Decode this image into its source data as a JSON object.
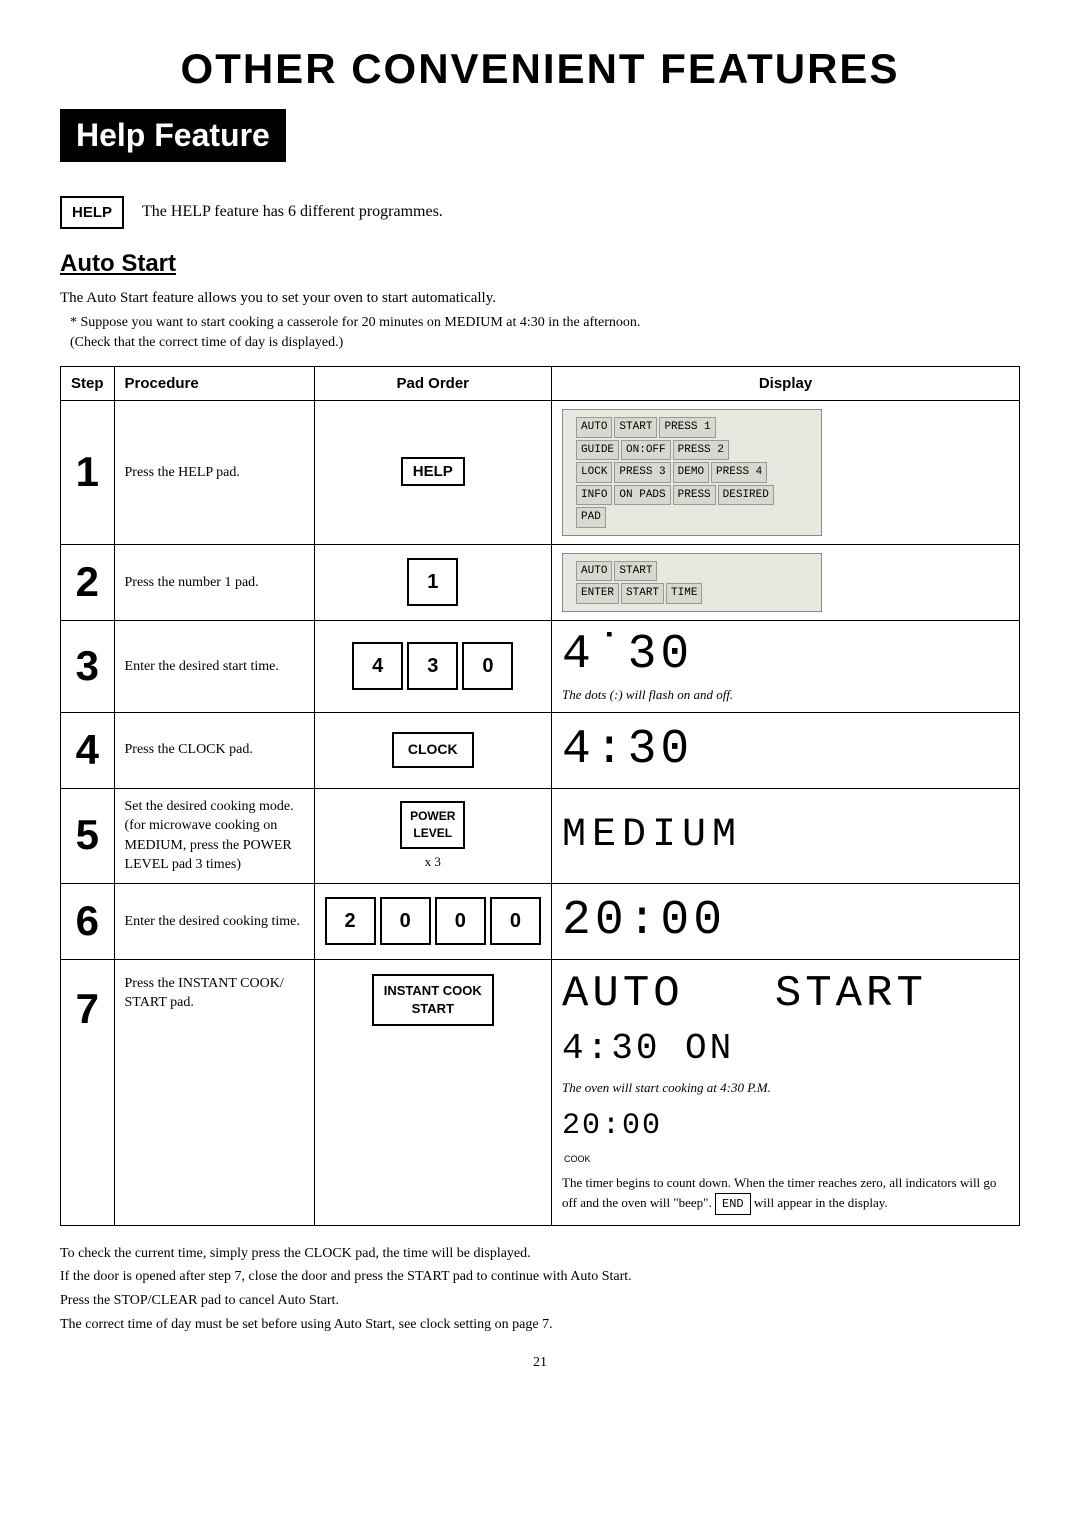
{
  "page": {
    "main_title": "OTHER CONVENIENT FEATURES",
    "help_feature_heading": "Help Feature",
    "help_button_label": "HELP",
    "help_description": "The HELP feature has 6 different programmes.",
    "auto_start_heading": "Auto Start",
    "intro_line1": "The Auto Start feature allows you to set your oven to start automatically.",
    "note_line": "* Suppose you want to start cooking a casserole for 20 minutes on MEDIUM at 4:30 in the afternoon.",
    "note_line2": "(Check that the correct time of day is displayed.)",
    "table_headers": {
      "step": "Step",
      "procedure": "Procedure",
      "pad_order": "Pad Order",
      "display": "Display"
    },
    "steps": [
      {
        "number": "1",
        "procedure": "Press the HELP pad.",
        "pad": "HELP",
        "display_type": "grid"
      },
      {
        "number": "2",
        "procedure": "Press the number 1 pad.",
        "pad": "1",
        "display_type": "simple_text",
        "display_text1": "AUTO  START",
        "display_text2": "ENTER  START  TIME"
      },
      {
        "number": "3",
        "procedure": "Enter the desired start time.",
        "pad": "4|3|0",
        "display_type": "clock_dots",
        "display_text": "4:30",
        "display_note": "The dots (:) will flash on and off."
      },
      {
        "number": "4",
        "procedure": "Press the CLOCK pad.",
        "pad": "CLOCK",
        "display_type": "clock",
        "display_text": "4:30"
      },
      {
        "number": "5",
        "procedure": "Set the desired cooking mode. (for microwave cooking on MEDIUM, press the POWER LEVEL pad 3 times)",
        "pad": "POWER_LEVEL",
        "display_type": "medium",
        "display_text": "MEDIUM"
      },
      {
        "number": "6",
        "procedure": "Enter the desired cooking time.",
        "pad": "2|0|0|0",
        "display_type": "time",
        "display_text": "20:00"
      },
      {
        "number": "7",
        "procedure": "Press the INSTANT COOK/ START pad.",
        "pad": "INSTANT_COOK_START",
        "display_type": "auto_start",
        "display_text1": "AUTO   START",
        "display_text2": "4:30 ON",
        "display_note": "The oven will start cooking at 4:30 P.M.",
        "display_text3": "20:00",
        "display_note2": "The timer begins to count down. When the timer reaches zero, all indicators will go off and the oven will \"beep\".",
        "end_label": "END"
      }
    ],
    "footnotes": [
      "To check the current time, simply press the CLOCK pad, the time will be displayed.",
      "If the door is opened after step 7, close the door and press the START pad to continue with Auto Start.",
      "Press the STOP/CLEAR pad to cancel Auto Start.",
      "The correct time of day must be set before using Auto Start, see clock setting on page 7."
    ],
    "page_number": "21"
  }
}
